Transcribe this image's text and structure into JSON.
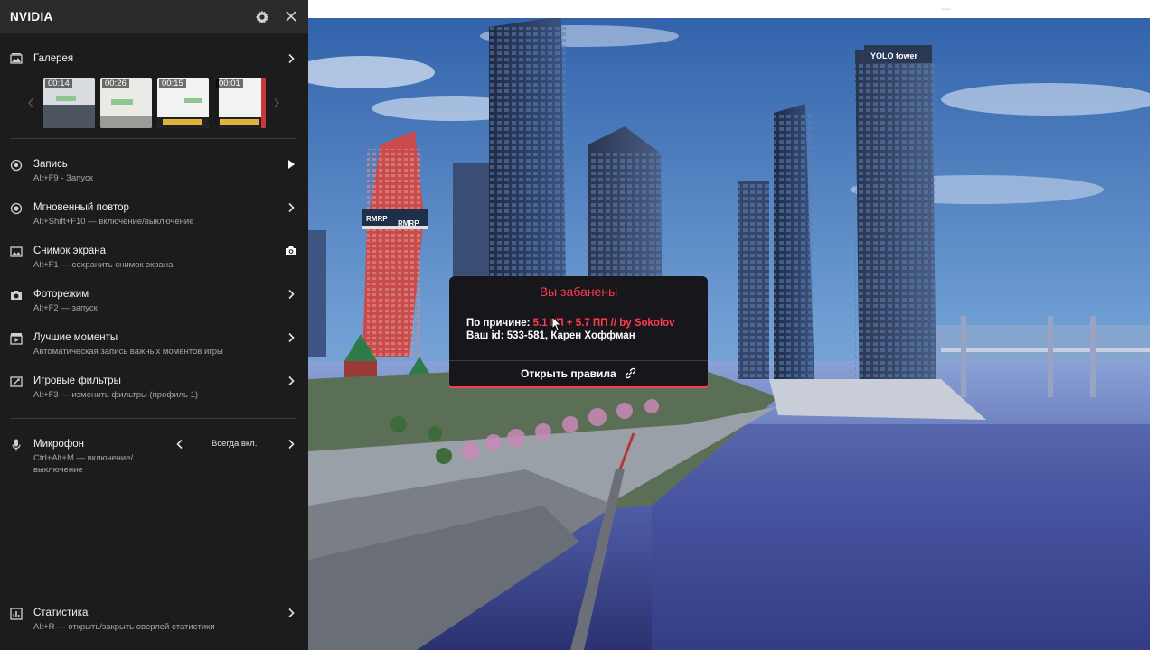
{
  "overlay": {
    "brand": "NVIDIA",
    "gallery": {
      "label": "Галерея",
      "thumbnails": [
        {
          "duration": "00:14"
        },
        {
          "duration": "00:26"
        },
        {
          "duration": "00:15"
        },
        {
          "duration": "00:01"
        }
      ]
    },
    "items": [
      {
        "label": "Запись",
        "sub": "Alt+F9 - Запуск"
      },
      {
        "label": "Мгновенный повтор",
        "sub": "Alt+Shift+F10 — включение/выключение"
      },
      {
        "label": "Снимок экрана",
        "sub": "Alt+F1 — сохранить снимок экрана"
      },
      {
        "label": "Фоторежим",
        "sub": "Alt+F2 — запуск"
      },
      {
        "label": "Лучшие моменты",
        "sub": "Автоматическая запись важных моментов игры"
      },
      {
        "label": "Игровые фильтры",
        "sub": "Alt+F3 — изменить фильтры (профиль 1)"
      }
    ],
    "microphone": {
      "label": "Микрофон",
      "sub_line1": "Ctrl+Alt+M — включение/",
      "sub_line2": "выключение",
      "value": "Всегда вкл."
    },
    "stats": {
      "label": "Статистика",
      "sub": "Alt+R — открыть/закрыть оверлей статистики"
    }
  },
  "ban_dialog": {
    "title": "Вы забанены",
    "reason_label": "По причине:",
    "reason_value": "5.1 ГП + 5.7 ПП // by Sokolov",
    "id_line": "Ваш id: 533-581, Карен Хоффман",
    "rules_button": "Открыть правила"
  },
  "game_signs": {
    "tower_left": "RMRP",
    "tower_left2": "RMRP",
    "tower_right": "YOLO tower"
  },
  "colors": {
    "accent_red": "#ff3b4e",
    "panel_bg": "#1c1c1c",
    "header_bg": "#2b2b2b"
  }
}
